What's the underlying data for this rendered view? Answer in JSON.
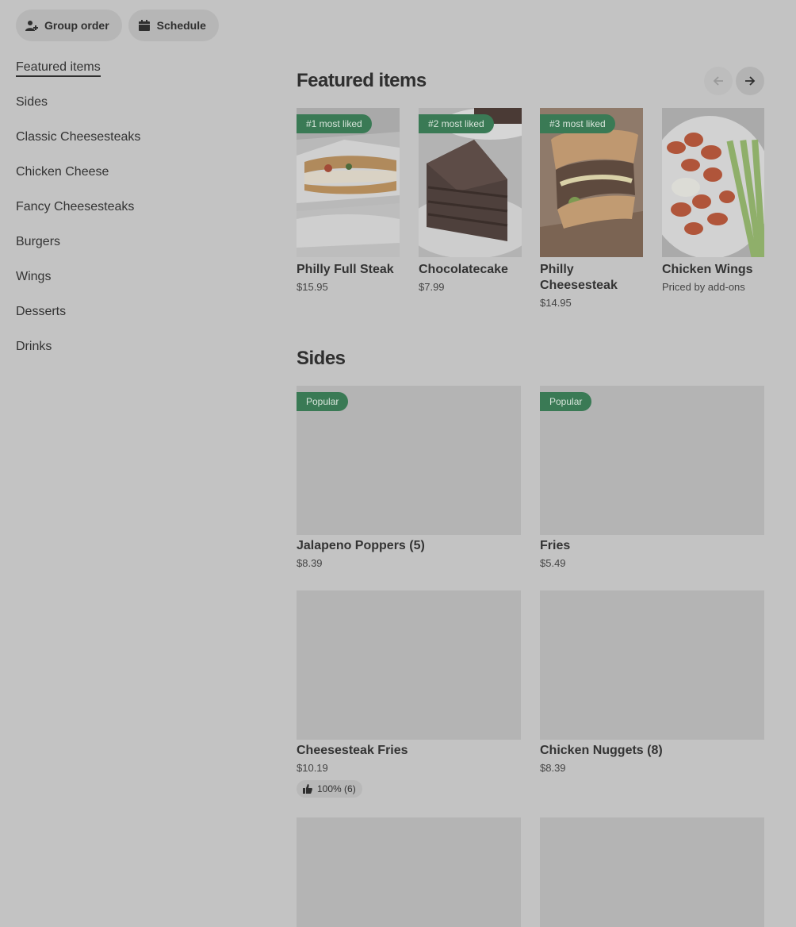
{
  "top_actions": {
    "group_order": "Group order",
    "schedule": "Schedule"
  },
  "sidebar": {
    "items": [
      {
        "label": "Featured items",
        "active": true
      },
      {
        "label": "Sides"
      },
      {
        "label": "Classic Cheesesteaks"
      },
      {
        "label": "Chicken Cheese"
      },
      {
        "label": "Fancy Cheesesteaks"
      },
      {
        "label": "Burgers"
      },
      {
        "label": "Wings"
      },
      {
        "label": "Desserts"
      },
      {
        "label": "Drinks"
      }
    ]
  },
  "featured": {
    "title": "Featured items",
    "items": [
      {
        "name": "Philly Full Steak",
        "price": "$15.95",
        "badge": "#1 most liked"
      },
      {
        "name": "Chocolatecake",
        "price": "$7.99",
        "badge": "#2 most liked"
      },
      {
        "name": "Philly Cheesesteak",
        "price": "$14.95",
        "badge": "#3 most liked"
      },
      {
        "name": "Chicken Wings",
        "price": "Priced by add-ons"
      }
    ]
  },
  "sides": {
    "title": "Sides",
    "items": [
      {
        "name": "Jalapeno Poppers (5)",
        "price": "$8.39",
        "badge": "Popular"
      },
      {
        "name": "Fries",
        "price": "$5.49",
        "badge": "Popular"
      },
      {
        "name": "Cheesesteak Fries",
        "price": "$10.19",
        "rating": "100% (6)"
      },
      {
        "name": "Chicken Nuggets (8)",
        "price": "$8.39"
      }
    ]
  },
  "colors": {
    "background": "#c3c3c3",
    "badge_green": "#3a7a55",
    "placeholder": "#b4b4b4"
  }
}
